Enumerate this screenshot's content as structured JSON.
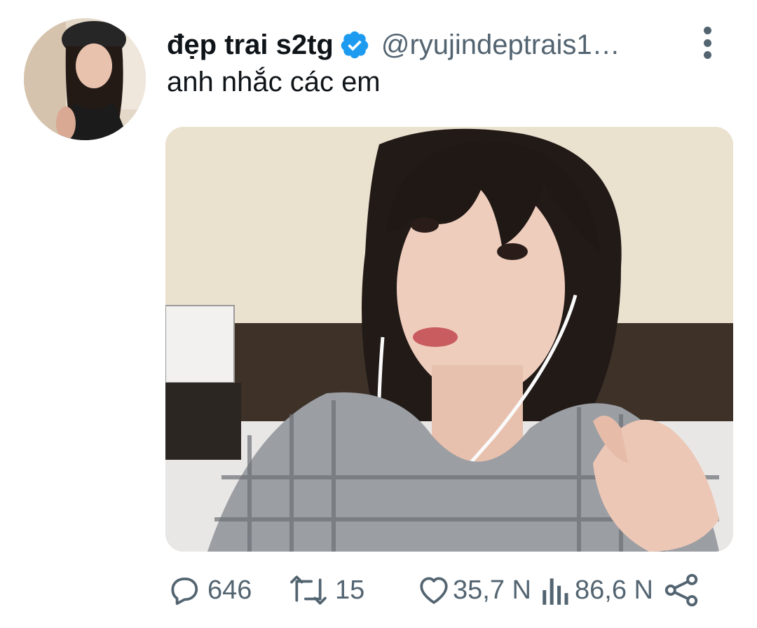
{
  "tweet": {
    "display_name": "đẹp trai s2tg",
    "verified_icon": "verified-badge-icon",
    "handle": "@ryujindeptrais1…",
    "more_icon": "more-vertical-icon",
    "text": "anh nhắc các em",
    "media_alt": "photo"
  },
  "actions": {
    "reply": {
      "icon": "reply-icon",
      "count": "646"
    },
    "retweet": {
      "icon": "retweet-icon",
      "count": "15"
    },
    "like": {
      "icon": "heart-icon",
      "count": "35,7 N"
    },
    "views": {
      "icon": "views-bar-icon",
      "count": "86,6 N"
    },
    "share": {
      "icon": "share-icon"
    }
  },
  "colors": {
    "verified": "#1d9bf0",
    "text_primary": "#0f1419",
    "text_secondary": "#536471"
  }
}
